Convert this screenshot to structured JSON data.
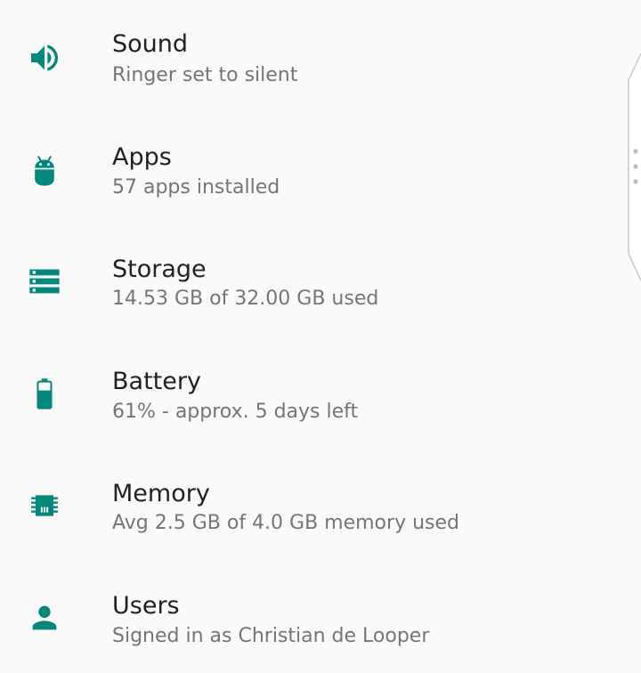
{
  "settings": {
    "items": [
      {
        "title": "Sound",
        "summary": "Ringer set to silent",
        "icon": "speaker-icon"
      },
      {
        "title": "Apps",
        "summary": "57 apps installed",
        "icon": "android-icon"
      },
      {
        "title": "Storage",
        "summary": "14.53 GB of 32.00 GB used",
        "icon": "storage-icon"
      },
      {
        "title": "Battery",
        "summary": "61% - approx. 5 days left",
        "icon": "battery-icon"
      },
      {
        "title": "Memory",
        "summary": "Avg 2.5 GB of 4.0 GB memory used",
        "icon": "memory-chip-icon"
      },
      {
        "title": "Users",
        "summary": "Signed in as Christian de Looper",
        "icon": "person-icon"
      }
    ]
  },
  "colors": {
    "accent": "#00897b",
    "background": "#fafafa",
    "title": "#212121",
    "summary": "#757575"
  }
}
